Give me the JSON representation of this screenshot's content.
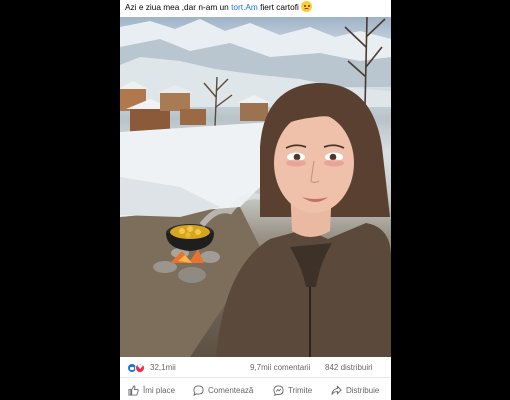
{
  "post": {
    "caption_prefix": "Azi e ziua mea ,dar n-am  un ",
    "caption_link": "tort.Am",
    "caption_suffix": " fiert cartofi",
    "caption_emoji_icon": "sad-face-emoji-icon"
  },
  "stats": {
    "reaction_icons": [
      "like-reaction-icon",
      "love-reaction-icon"
    ],
    "reaction_count": "32,1mii",
    "comments": "9,7mii comentarii",
    "shares": "842 distribuiri"
  },
  "actions": {
    "like": "Îmi place",
    "comment": "Comentează",
    "send": "Trimite",
    "share": "Distribuie"
  },
  "colors": {
    "link": "#1b74e4",
    "like": "#1b74e4",
    "love": "#f02849",
    "muted_text": "#65676b"
  }
}
